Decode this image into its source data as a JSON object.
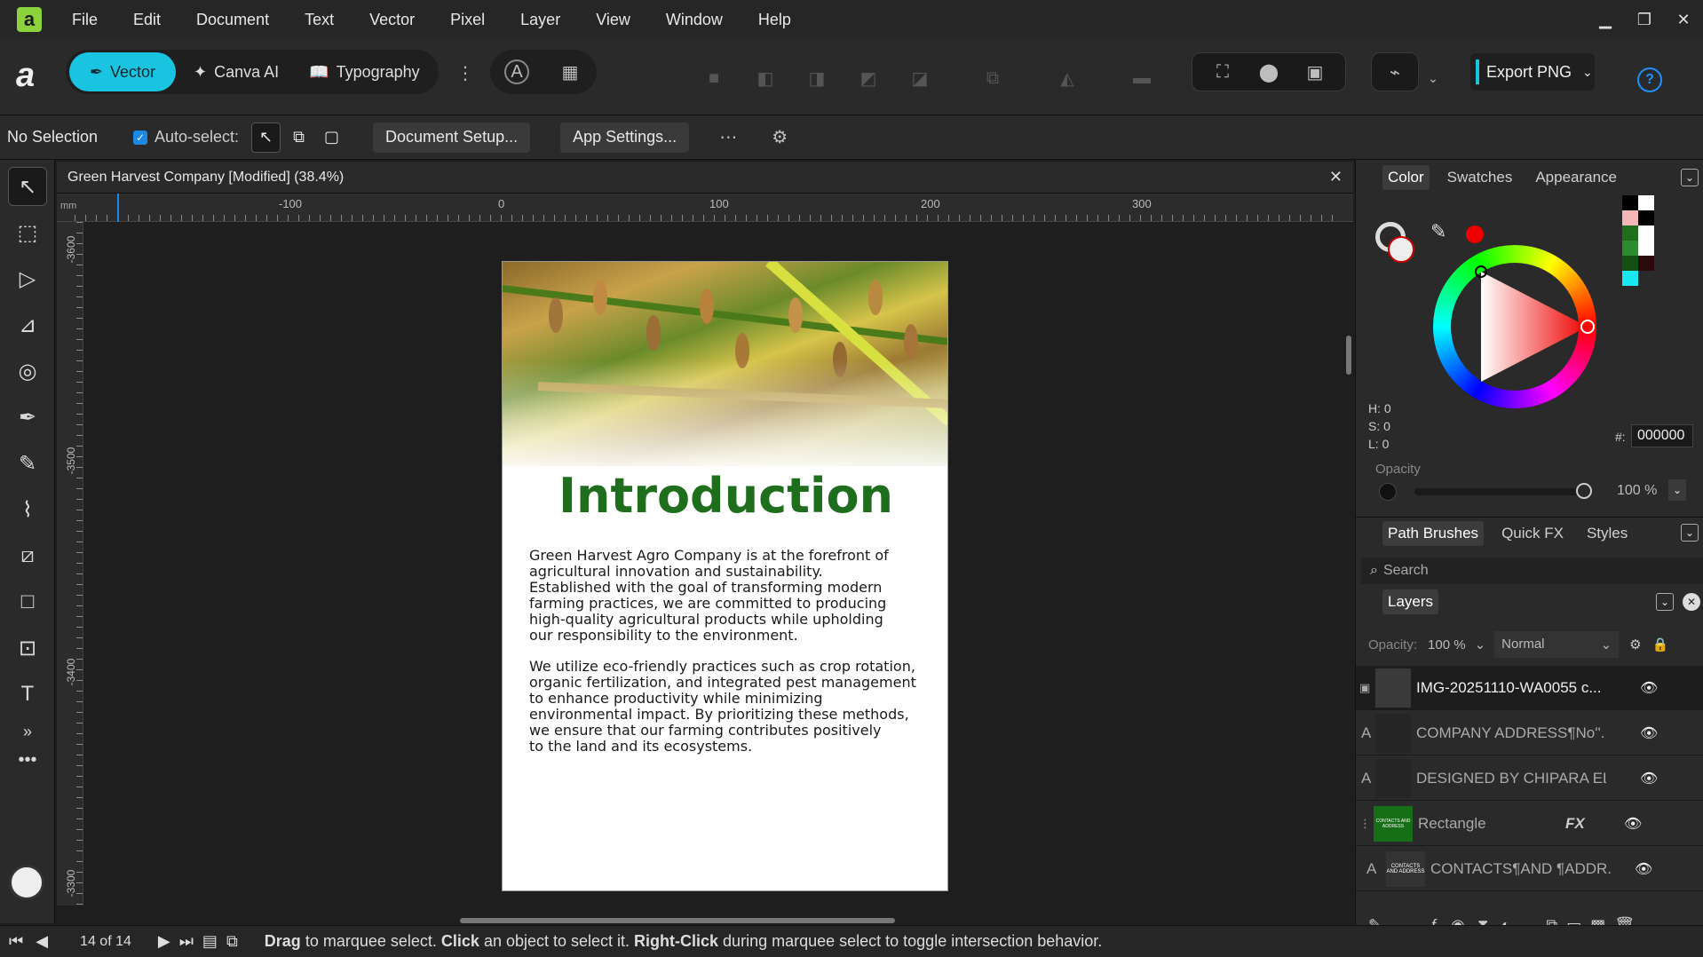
{
  "app": {
    "logo_letter": "a"
  },
  "menu": [
    "File",
    "Edit",
    "Document",
    "Text",
    "Vector",
    "Pixel",
    "Layer",
    "View",
    "Window",
    "Help"
  ],
  "toolbar": {
    "personas": [
      {
        "label": "Vector",
        "active": true
      },
      {
        "label": "Canva AI",
        "active": false
      },
      {
        "label": "Typography",
        "active": false
      }
    ],
    "export_label": "Export PNG",
    "help_label": "?"
  },
  "context": {
    "selection": "No Selection",
    "auto_select": "Auto-select:",
    "document_setup": "Document Setup...",
    "app_settings": "App Settings..."
  },
  "document": {
    "tab_title": "Green Harvest Company [Modified] (38.4%)",
    "ruler_unit": "mm",
    "h_ticks": [
      "-100",
      "0",
      "100",
      "200",
      "300"
    ],
    "v_ticks": [
      "-3600",
      "-3500",
      "-3400",
      "-3300"
    ]
  },
  "page": {
    "title": "Introduction",
    "para1": [
      "Green Harvest Agro Company is at the forefront of",
      "agricultural innovation and sustainability.",
      "Established with the goal of transforming modern",
      "farming practices, we are committed to producing",
      "high-quality agricultural products while upholding",
      "our responsibility to the environment."
    ],
    "para2": [
      "We utilize eco-friendly practices such as crop rotation,",
      "organic fertilization, and integrated pest management",
      "to enhance productivity while minimizing",
      "environmental impact. By prioritizing these methods,",
      "we ensure that our farming contributes positively",
      "to the land and its ecosystems."
    ]
  },
  "color_panel": {
    "tabs": [
      "Color",
      "Swatches",
      "Appearance"
    ],
    "hsl": [
      "H: 0",
      "S: 0",
      "L: 0"
    ],
    "hex_label": "#:",
    "hex_value": "000000",
    "opacity_label": "Opacity",
    "opacity_value": "100 %",
    "accent": "#ff0000"
  },
  "brush_panel": {
    "tabs": [
      "Path Brushes",
      "Quick FX",
      "Styles"
    ],
    "search_placeholder": "Search"
  },
  "layers_panel": {
    "title": "Layers",
    "opacity_label": "Opacity:",
    "opacity_value": "100 %",
    "blend_mode": "Normal",
    "rows": [
      {
        "type": "image",
        "name": "IMG-20251110-WA0055 c...",
        "fx": ""
      },
      {
        "type": "A",
        "name": "COMPANY ADDRESS¶No''...",
        "fx": ""
      },
      {
        "type": "A",
        "name": "DESIGNED BY CHIPARA ELI...",
        "fx": ""
      },
      {
        "type": "shape",
        "name": "Rectangle",
        "fx": "FX"
      },
      {
        "type": "A",
        "name": "CONTACTS¶AND ¶ADDR...",
        "fx": ""
      }
    ],
    "thumb_text": "CONTACTS AND ADDRESS"
  },
  "status": {
    "page": "14 of 14",
    "hint_drag_b": "Drag",
    "hint_drag": " to marquee select. ",
    "hint_click_b": "Click",
    "hint_click": " an object to select it. ",
    "hint_right_b": "Right-Click",
    "hint_right": " during marquee select to toggle intersection behavior."
  }
}
